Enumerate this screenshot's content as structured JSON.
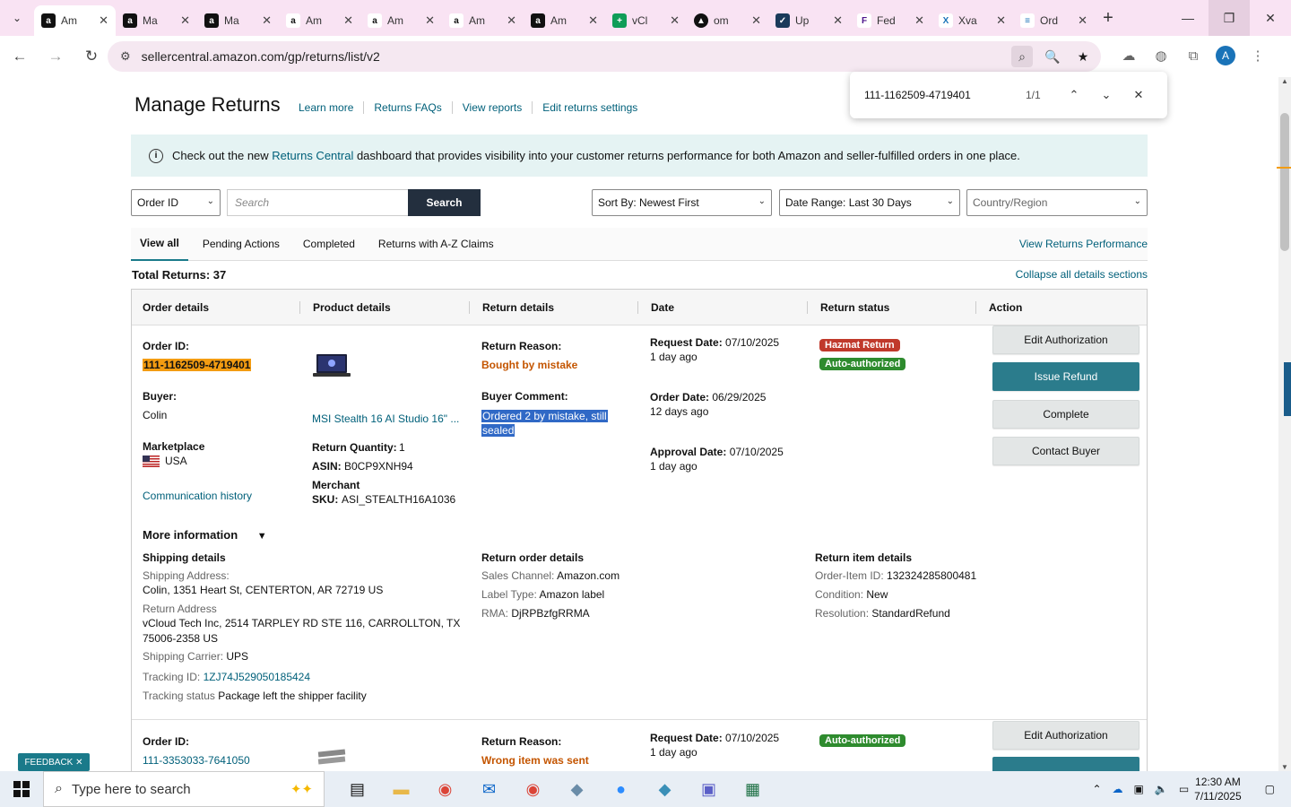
{
  "browser": {
    "tabs": [
      {
        "title": "Am",
        "favicon": "amazon-icon",
        "active": true
      },
      {
        "title": "Ma",
        "favicon": "amazon-icon"
      },
      {
        "title": "Ma",
        "favicon": "amazon-icon"
      },
      {
        "title": "Am",
        "favicon": "amazon-smile-icon"
      },
      {
        "title": "Am",
        "favicon": "amazon-smile-icon"
      },
      {
        "title": "Am",
        "favicon": "amazon-smile-icon"
      },
      {
        "title": "Am",
        "favicon": "amazon-icon"
      },
      {
        "title": "vCl",
        "favicon": "sheets-icon"
      },
      {
        "title": "om",
        "favicon": "triangle-icon"
      },
      {
        "title": "Up",
        "favicon": "check-icon"
      },
      {
        "title": "Fed",
        "favicon": "fedex-icon"
      },
      {
        "title": "Xva",
        "favicon": "xva-icon"
      },
      {
        "title": "Ord",
        "favicon": "order-icon"
      }
    ],
    "url": "sellercentral.amazon.com/gp/returns/list/v2",
    "profile_initial": "A"
  },
  "find_bar": {
    "query": "111-1162509-4719401",
    "count": "1/1"
  },
  "page": {
    "title": "Manage Returns",
    "links": [
      "Learn more",
      "Returns FAQs",
      "View reports",
      "Edit returns settings"
    ],
    "banner": {
      "prefix": "Check out the new ",
      "link": "Returns Central",
      "suffix": " dashboard that provides visibility into your customer returns performance for both Amazon and seller-fulfilled orders in one place."
    },
    "filters": {
      "search_type": "Order ID",
      "search_placeholder": "Search",
      "search_button": "Search",
      "sort": "Sort By: Newest First",
      "date_range": "Date Range: Last 30 Days",
      "country": "Country/Region"
    },
    "tabs": [
      "View all",
      "Pending Actions",
      "Completed",
      "Returns with A-Z Claims"
    ],
    "view_performance": "View Returns Performance",
    "total_label": "Total Returns: 37",
    "collapse_label": "Collapse all details sections",
    "columns": [
      "Order details",
      "Product details",
      "Return details",
      "Date",
      "Return status",
      "Action"
    ]
  },
  "return1": {
    "order_id_label": "Order ID:",
    "order_id": "111-1162509-4719401",
    "buyer_label": "Buyer:",
    "buyer": "Colin",
    "marketplace_label": "Marketplace",
    "marketplace": "USA",
    "comm_history": "Communication history",
    "product_name": "MSI Stealth 16 AI Studio 16\" ...",
    "qty_label": "Return Quantity:",
    "qty": "1",
    "asin_label": "ASIN:",
    "asin": "B0CP9XNH94",
    "merchant_label": "Merchant",
    "sku_label": "SKU:",
    "sku": "ASI_STEALTH16A1036",
    "reason_label": "Return Reason:",
    "reason": "Bought by mistake",
    "comment_label": "Buyer Comment:",
    "comment_line1": "Ordered 2 by mistake, still",
    "comment_line2": "sealed",
    "request_label": "Request Date:",
    "request_date": "07/10/2025",
    "request_ago": "1 day ago",
    "order_label": "Order Date:",
    "order_date": "06/29/2025",
    "order_ago": "12 days ago",
    "approval_label": "Approval Date:",
    "approval_date": "07/10/2025",
    "approval_ago": "1 day ago",
    "badge_hazmat": "Hazmat Return",
    "badge_auth": "Auto-authorized",
    "btn_edit": "Edit Authorization",
    "btn_refund": "Issue Refund",
    "btn_complete": "Complete",
    "btn_contact": "Contact Buyer",
    "more_info": "More information",
    "shipping": {
      "heading": "Shipping details",
      "address_label": "Shipping Address:",
      "address": "Colin, 1351 Heart St, CENTERTON, AR 72719 US",
      "return_label": "Return Address",
      "return_line1": "vCloud Tech Inc, 2514 TARPLEY RD STE 116, CARROLLTON, TX",
      "return_line2": "75006-2358 US",
      "carrier_label": "Shipping Carrier:",
      "carrier": "UPS",
      "tracking_label": "Tracking ID:",
      "tracking": "1ZJ74J529050185424",
      "status_label": "Tracking status",
      "status": "Package left the shipper facility"
    },
    "order_details": {
      "heading": "Return order details",
      "channel_label": "Sales Channel:",
      "channel": "Amazon.com",
      "label_type_label": "Label Type:",
      "label_type": "Amazon label",
      "rma_label": "RMA:",
      "rma": "DjRPBzfgRRMA"
    },
    "item_details": {
      "heading": "Return item details",
      "order_item_label": "Order-Item ID:",
      "order_item": "132324285800481",
      "condition_label": "Condition:",
      "condition": "New",
      "resolution_label": "Resolution:",
      "resolution": "StandardRefund"
    }
  },
  "return2": {
    "order_id_label": "Order ID:",
    "order_id": "111-3353033-7641050",
    "reason_label": "Return Reason:",
    "reason": "Wrong item was sent",
    "request_label": "Request Date:",
    "request_date": "07/10/2025",
    "request_ago": "1 day ago",
    "badge_auth": "Auto-authorized",
    "btn_edit": "Edit Authorization"
  },
  "feedback": "FEEDBACK",
  "taskbar": {
    "search_placeholder": "Type here to search",
    "time": "12:30 AM",
    "date": "7/11/2025"
  },
  "colors": {
    "teal": "#00607a",
    "hazmat": "#c0392b",
    "auto": "#2e8b2e",
    "highlight": "#f39c12"
  }
}
